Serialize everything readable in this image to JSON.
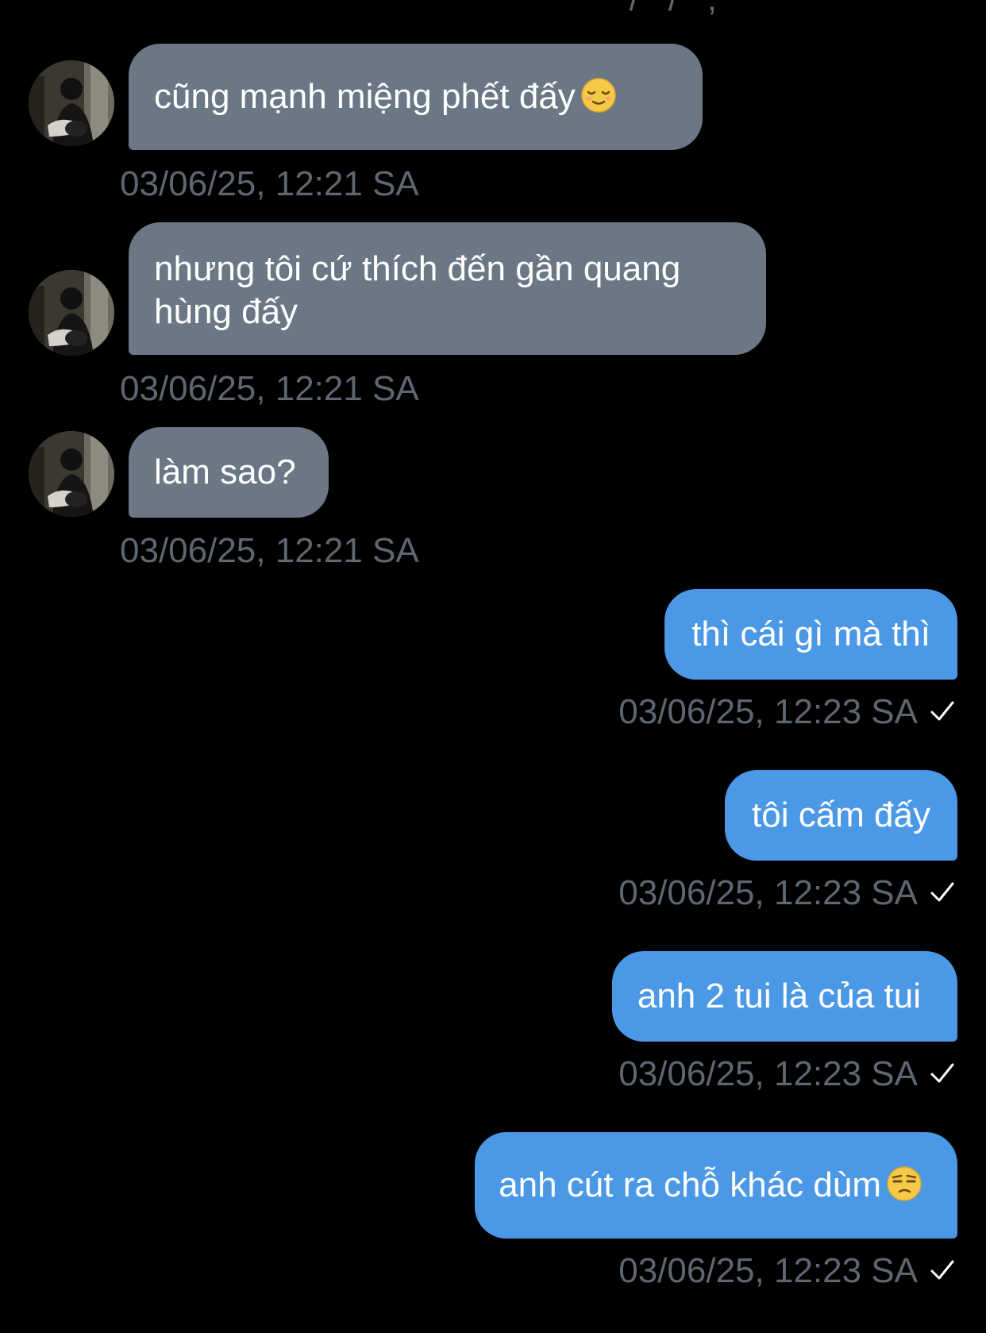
{
  "top_partial_timestamp": "' / ' / ' ,",
  "messages": [
    {
      "direction": "incoming",
      "text": "cũng mạnh miệng phết đấy",
      "emoji": "relieved-face",
      "time": "03/06/25, 12:21 SA"
    },
    {
      "direction": "incoming",
      "text": "nhưng tôi cứ thích đến gần quang\nhùng đấy",
      "time": "03/06/25, 12:21 SA"
    },
    {
      "direction": "incoming",
      "text": "làm sao?",
      "time": "03/06/25, 12:21 SA"
    },
    {
      "direction": "outgoing",
      "text": "thì cái gì mà thì",
      "time": "03/06/25, 12:23 SA",
      "status_icon": "checkmark-icon"
    },
    {
      "direction": "outgoing",
      "text": "tôi cấm đấy",
      "time": "03/06/25, 12:23 SA",
      "status_icon": "checkmark-icon"
    },
    {
      "direction": "outgoing",
      "text": "anh 2 tui là của tui",
      "time": "03/06/25, 12:23 SA",
      "status_icon": "checkmark-icon"
    },
    {
      "direction": "outgoing",
      "text": "anh cút ra chỗ khác dùm",
      "emoji": "unamused-face",
      "time": "03/06/25, 12:23 SA",
      "status_icon": "checkmark-icon"
    }
  ],
  "colors": {
    "background": "#000000",
    "incoming_bubble": "#6b7784",
    "outgoing_bubble": "#4a98e6",
    "timestamp": "#5e6672",
    "text": "#ffffff"
  }
}
